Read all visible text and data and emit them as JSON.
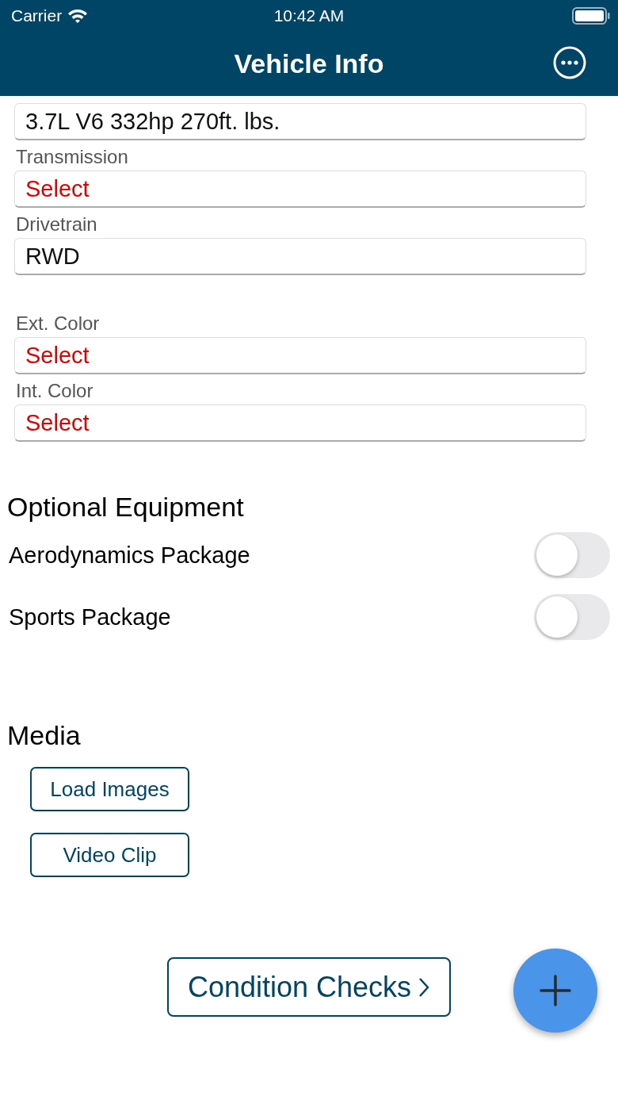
{
  "status_bar": {
    "carrier": "Carrier",
    "time": "10:42 AM"
  },
  "nav": {
    "title": "Vehicle Info"
  },
  "field_groups": [
    [
      {
        "value": "3.7L V6 332hp 270ft. lbs."
      },
      {
        "label": "Transmission",
        "placeholder": "Select"
      },
      {
        "label": "Drivetrain",
        "value": "RWD"
      }
    ],
    [
      {
        "label": "Ext. Color",
        "placeholder": "Select"
      },
      {
        "label": "Int. Color",
        "placeholder": "Select"
      }
    ]
  ],
  "optional_equipment": {
    "title": "Optional Equipment",
    "items": [
      {
        "label": "Aerodynamics Package",
        "on": false
      },
      {
        "label": "Sports Package",
        "on": false
      }
    ]
  },
  "media": {
    "title": "Media",
    "buttons": [
      "Load Images",
      "Video Clip"
    ]
  },
  "condition_button": "Condition Checks"
}
